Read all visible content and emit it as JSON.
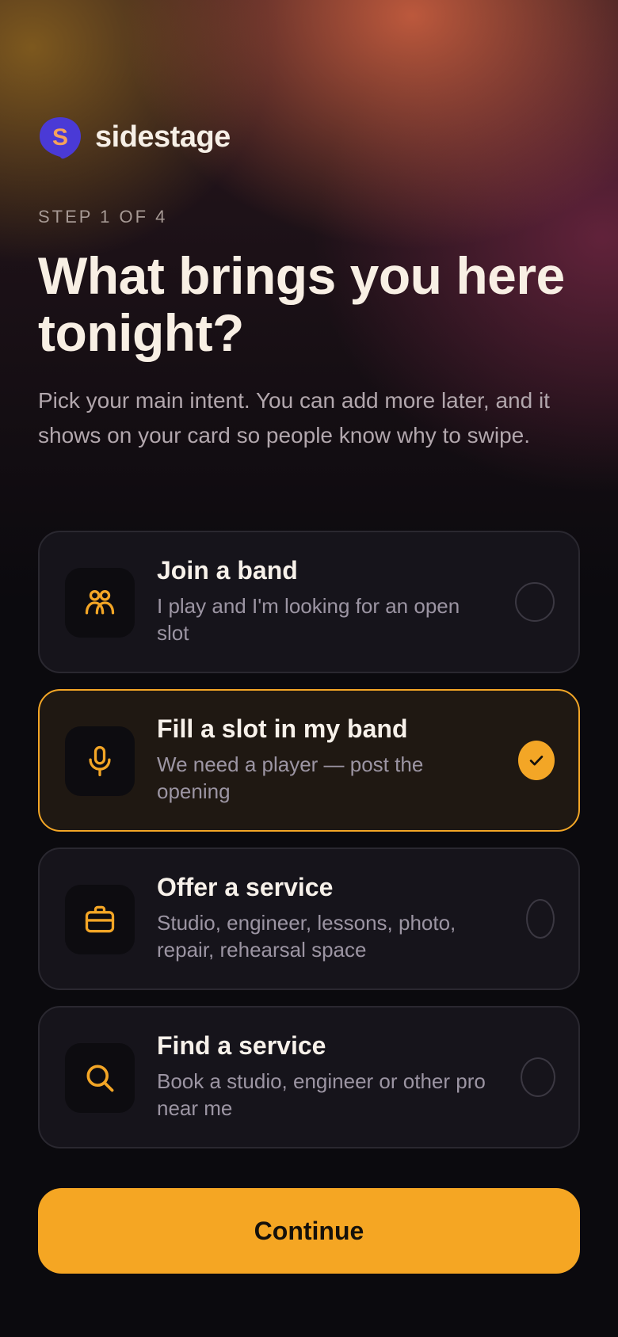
{
  "brand": {
    "name": "sidestage",
    "logo_letter": "S"
  },
  "step_label": "STEP 1 OF 4",
  "title": "What brings you here tonight?",
  "subtitle": "Pick your main intent. You can add more later, and it shows on your card so people know why to swipe.",
  "options": [
    {
      "title": "Join a band",
      "description": "I play and I'm looking for an open slot",
      "icon": "people-icon",
      "selected": false
    },
    {
      "title": "Fill a slot in my band",
      "description": "We need a player — post the opening",
      "icon": "microphone-icon",
      "selected": true
    },
    {
      "title": "Offer a service",
      "description": "Studio, engineer, lessons, photo, repair, rehearsal space",
      "icon": "briefcase-icon",
      "selected": false
    },
    {
      "title": "Find a service",
      "description": "Book a studio, engineer or other pro near me",
      "icon": "search-icon",
      "selected": false
    }
  ],
  "cta_label": "Continue",
  "colors": {
    "accent": "#f5a623",
    "background": "#0b0a0e",
    "card": "#16141b",
    "logo": "#4a3ad6"
  }
}
